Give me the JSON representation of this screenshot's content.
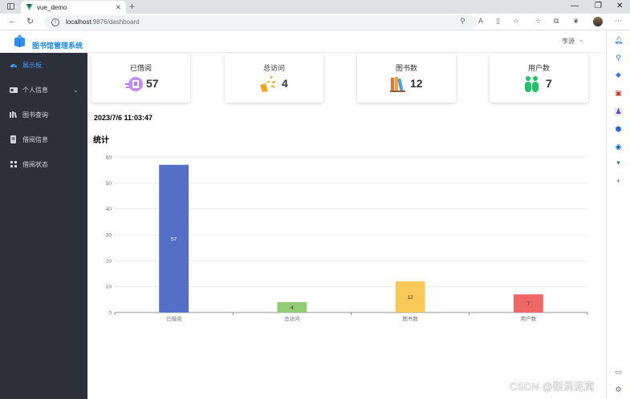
{
  "browser": {
    "tab_title": "vue_demo",
    "url_host": "localhost",
    "url_path": ":9876/dashboard"
  },
  "app": {
    "title": "图书馆管理系统",
    "user": "李源"
  },
  "sidebar": {
    "items": [
      {
        "label": "展示板",
        "icon": "dashboard-icon"
      },
      {
        "label": "个人信息",
        "icon": "id-card-icon"
      },
      {
        "label": "图书查询",
        "icon": "books-icon"
      },
      {
        "label": "借阅信息",
        "icon": "document-icon"
      },
      {
        "label": "借阅状态",
        "icon": "grid-icon"
      }
    ]
  },
  "cards": [
    {
      "label": "已借阅",
      "value": "57",
      "icon": "borrow-icon",
      "color": "#b57bf0"
    },
    {
      "label": "总访问",
      "value": "4",
      "icon": "visit-icon",
      "color": "#f5a623"
    },
    {
      "label": "图书数",
      "value": "12",
      "icon": "books-stack-icon",
      "color": "#e5733a"
    },
    {
      "label": "用户数",
      "value": "7",
      "icon": "users-icon",
      "color": "#21c46b"
    }
  ],
  "datetime": "2023/7/6 11:03:47",
  "section_title": "统计",
  "chart_data": {
    "type": "bar",
    "categories": [
      "已借阅",
      "总访问",
      "图书数",
      "用户数"
    ],
    "values": [
      57,
      4,
      12,
      7
    ],
    "colors": [
      "#5470c6",
      "#91cc75",
      "#fac858",
      "#ee6666"
    ],
    "ylim": [
      0,
      60
    ],
    "yticks": [
      0,
      10,
      20,
      30,
      40,
      50,
      60
    ],
    "grid": true,
    "data_labels": true
  },
  "watermark": "CSDN @梨涡泥窝"
}
